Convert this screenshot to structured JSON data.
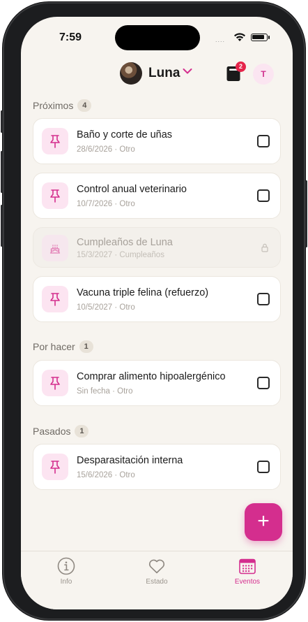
{
  "status": {
    "time": "7:59",
    "dots": "....",
    "wifi_icon": "wifi-icon",
    "battery_icon": "battery-icon"
  },
  "header": {
    "pet_name": "Luna",
    "notifications_count": "2",
    "user_initial": "T",
    "accent": "#d42e8e"
  },
  "sections": [
    {
      "title": "Próximos",
      "count": "4",
      "items": [
        {
          "title": "Baño y corte de uñas",
          "subtitle": "28/6/2026 · Otro",
          "icon": "pin-icon",
          "state": "todo"
        },
        {
          "title": "Control anual veterinario",
          "subtitle": "10/7/2026 · Otro",
          "icon": "pin-icon",
          "state": "todo"
        },
        {
          "title": "Cumpleaños de Luna",
          "subtitle": "15/3/2027 · Cumpleaños",
          "icon": "cake-icon",
          "state": "locked"
        },
        {
          "title": "Vacuna triple felina (refuerzo)",
          "subtitle": "10/5/2027 · Otro",
          "icon": "pin-icon",
          "state": "todo"
        }
      ]
    },
    {
      "title": "Por hacer",
      "count": "1",
      "items": [
        {
          "title": "Comprar alimento hipoalergénico",
          "subtitle": "Sin fecha · Otro",
          "icon": "pin-icon",
          "state": "todo"
        }
      ]
    },
    {
      "title": "Pasados",
      "count": "1",
      "items": [
        {
          "title": "Desparasitación interna",
          "subtitle": "15/6/2026 · Otro",
          "icon": "pin-icon",
          "state": "todo"
        }
      ]
    }
  ],
  "fab": {
    "label": "+"
  },
  "tabs": [
    {
      "label": "Info",
      "icon": "info-icon",
      "active": false
    },
    {
      "label": "Estado",
      "icon": "heart-icon",
      "active": false
    },
    {
      "label": "Eventos",
      "icon": "calendar-icon",
      "active": true
    }
  ]
}
